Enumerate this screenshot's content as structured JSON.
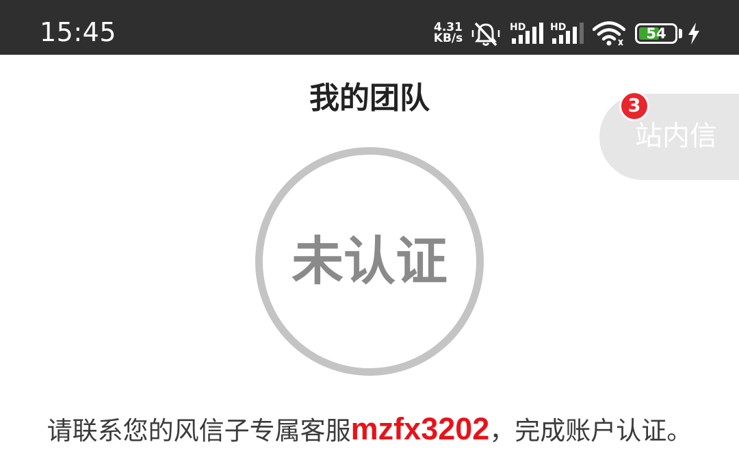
{
  "status_bar": {
    "time": "15:45",
    "net_speed_value": "4.31",
    "net_speed_unit": "KB/s",
    "sim1_label": "HD",
    "sim2_label": "HD",
    "battery_level": "54",
    "icons": [
      "mute-vibrate-icon",
      "signal-icon",
      "signal-icon",
      "wifi-icon",
      "battery-icon",
      "charging-icon"
    ],
    "battery_color": "#3ea72e"
  },
  "header": {
    "title": "我的团队"
  },
  "message_tab": {
    "label": "站内信",
    "badge_count": "3",
    "badge_color": "#e8262c"
  },
  "verification": {
    "status": "未认证"
  },
  "instruction": {
    "prefix": "请联系您的风信子专属客服",
    "contact_id": "mzfx3202",
    "suffix": "，完成账户认证。",
    "highlight_color": "#e8131a"
  }
}
